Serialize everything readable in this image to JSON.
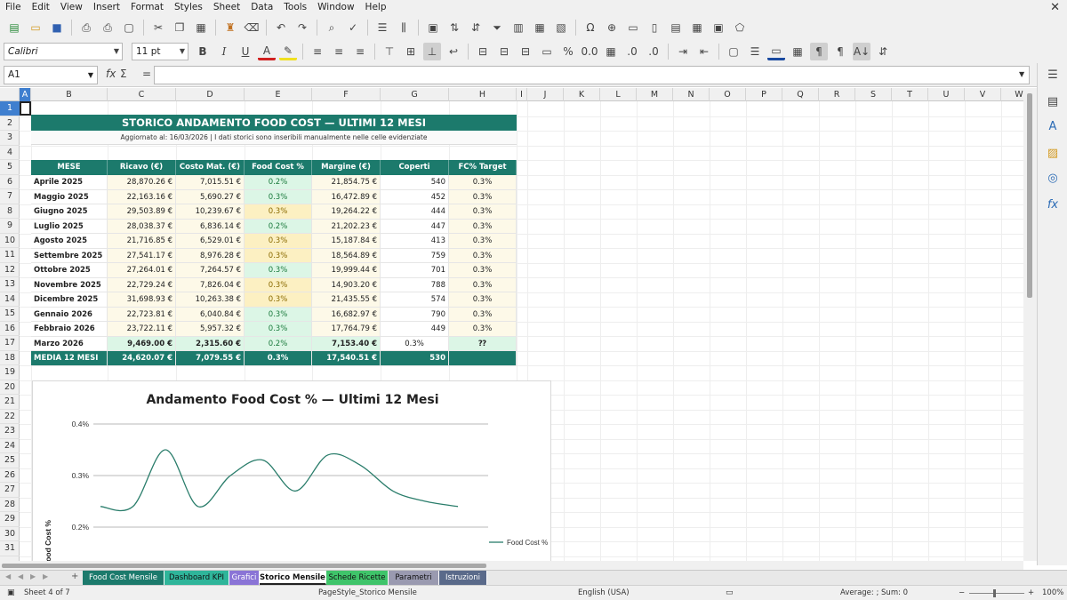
{
  "menu": [
    "File",
    "Edit",
    "View",
    "Insert",
    "Format",
    "Styles",
    "Sheet",
    "Data",
    "Tools",
    "Window",
    "Help"
  ],
  "toolbar": {
    "font_name": "Calibri",
    "font_size": "11 pt"
  },
  "formula": {
    "cell_ref": "A1",
    "fx": "fx",
    "sigma": "Σ",
    "eq": "="
  },
  "columns": [
    "A",
    "B",
    "C",
    "D",
    "E",
    "F",
    "G",
    "H",
    "I",
    "J",
    "K",
    "L",
    "M",
    "N",
    "O",
    "P",
    "Q",
    "R",
    "S",
    "T",
    "U",
    "V",
    "W"
  ],
  "rows": [
    "1",
    "2",
    "3",
    "4",
    "5",
    "6",
    "7",
    "8",
    "9",
    "10",
    "11",
    "12",
    "13",
    "14",
    "15",
    "16",
    "17",
    "18",
    "19",
    "20",
    "21",
    "22",
    "23",
    "24",
    "25",
    "26",
    "27",
    "28",
    "29",
    "30",
    "31"
  ],
  "table": {
    "title": "STORICO ANDAMENTO FOOD COST — ULTIMI 12 MESI",
    "subtitle": "Aggiornato al: 16/03/2026   |   I dati storici sono inseribili manualmente nelle celle evidenziate",
    "headers": [
      "MESE",
      "Ricavo (€)",
      "Costo Mat. (€)",
      "Food Cost %",
      "Margine (€)",
      "Coperti",
      "FC% Target"
    ],
    "rows": [
      [
        "Aprile 2025",
        "28,870.26 €",
        "7,015.51 €",
        "0.2%",
        "21,854.75 €",
        "540",
        "0.3%"
      ],
      [
        "Maggio 2025",
        "22,163.16 €",
        "5,690.27 €",
        "0.3%",
        "16,472.89 €",
        "452",
        "0.3%"
      ],
      [
        "Giugno 2025",
        "29,503.89 €",
        "10,239.67 €",
        "0.3%",
        "19,264.22 €",
        "444",
        "0.3%"
      ],
      [
        "Luglio 2025",
        "28,038.37 €",
        "6,836.14 €",
        "0.2%",
        "21,202.23 €",
        "447",
        "0.3%"
      ],
      [
        "Agosto 2025",
        "21,716.85 €",
        "6,529.01 €",
        "0.3%",
        "15,187.84 €",
        "413",
        "0.3%"
      ],
      [
        "Settembre 2025",
        "27,541.17 €",
        "8,976.28 €",
        "0.3%",
        "18,564.89 €",
        "759",
        "0.3%"
      ],
      [
        "Ottobre 2025",
        "27,264.01 €",
        "7,264.57 €",
        "0.3%",
        "19,999.44 €",
        "701",
        "0.3%"
      ],
      [
        "Novembre 2025",
        "22,729.24 €",
        "7,826.04 €",
        "0.3%",
        "14,903.20 €",
        "788",
        "0.3%"
      ],
      [
        "Dicembre 2025",
        "31,698.93 €",
        "10,263.38 €",
        "0.3%",
        "21,435.55 €",
        "574",
        "0.3%"
      ],
      [
        "Gennaio 2026",
        "22,723.81 €",
        "6,040.84 €",
        "0.3%",
        "16,682.97 €",
        "790",
        "0.3%"
      ],
      [
        "Febbraio 2026",
        "23,722.11 €",
        "5,957.32 €",
        "0.3%",
        "17,764.79 €",
        "449",
        "0.3%"
      ],
      [
        "Marzo 2026",
        "9,469.00 €",
        "2,315.60 €",
        "0.2%",
        "7,153.40 €",
        "0.3%",
        "⁇"
      ],
      [
        "MEDIA 12 MESI",
        "24,620.07 €",
        "7,079.55 €",
        "0.3%",
        "17,540.51 €",
        "530",
        ""
      ]
    ],
    "fc_highlight": [
      "green",
      "green",
      "yellow",
      "green",
      "yellow",
      "yellow",
      "green",
      "yellow",
      "yellow",
      "green",
      "green",
      "green",
      "none"
    ]
  },
  "chart_data": {
    "type": "line",
    "title": "Andamento Food Cost % — Ultimi 12 Mesi",
    "ylabel": "Food Cost %",
    "yticks": [
      "0.4%",
      "0.3%",
      "0.2%"
    ],
    "ylim": [
      0.2,
      0.4
    ],
    "series": [
      {
        "name": "Food Cost %",
        "color": "#2a7d6b",
        "values": [
          0.24,
          0.24,
          0.35,
          0.24,
          0.3,
          0.33,
          0.27,
          0.34,
          0.32,
          0.27,
          0.25,
          0.24
        ]
      }
    ],
    "legend": "right",
    "grid": true
  },
  "tabs": [
    "Food Cost Mensile",
    "Dashboard KPI",
    "Grafici",
    "Storico Mensile",
    "Schede Ricette",
    "Parametri",
    "Istruzioni"
  ],
  "tab_colors": [
    "#1c7a6c",
    "#2fb59a",
    "#8a74d6",
    "#ffffff",
    "#3fc46a",
    "#9a9ab0",
    "#5a6a8a"
  ],
  "status": {
    "sheet": "Sheet 4 of 7",
    "pagestyle": "PageStyle_Storico Mensile",
    "language": "English (USA)",
    "summary": "Average: ; Sum: 0",
    "zoom": "100%"
  }
}
